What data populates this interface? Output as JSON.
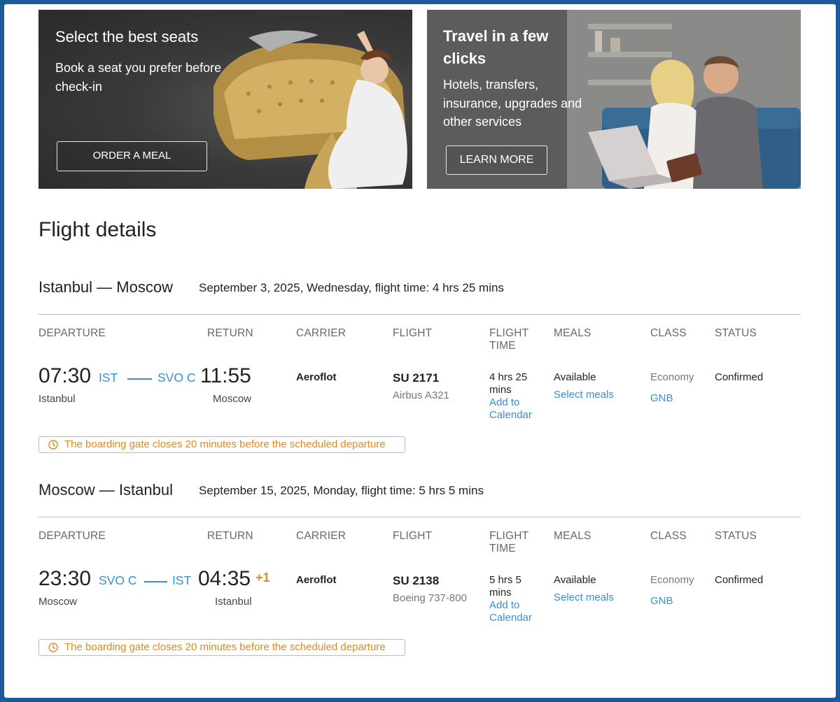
{
  "banners": [
    {
      "title": "Select the best seats",
      "text": "Book a seat you prefer before check-in",
      "button": "ORDER A MEAL"
    },
    {
      "title": "Travel in a few clicks",
      "text": "Hotels, transfers, insurance, upgrades and other services",
      "button": "LEARN MORE"
    }
  ],
  "page_title": "Flight details",
  "columns": {
    "departure": "DEPARTURE",
    "return": "RETURN",
    "carrier": "CARRIER",
    "flight": "FLIGHT",
    "flight_time": "FLIGHT TIME",
    "meals": "MEALS",
    "class": "CLASS",
    "status": "STATUS"
  },
  "segments": [
    {
      "route": "Istanbul — Moscow",
      "info": "September 3, 2025, Wednesday, flight time: 4 hrs 25 mins",
      "dep_time": "07:30",
      "dep_code": "IST",
      "dep_city": "Istanbul",
      "arr_code": "SVO C",
      "arr_time": "11:55",
      "arr_plus": "",
      "arr_city": "Moscow",
      "carrier": "Aeroflot",
      "flight_no": "SU 2171",
      "aircraft": "Airbus A321",
      "duration": "4 hrs 25 mins",
      "calendar": "Add to Calendar",
      "meals_status": "Available",
      "meals_link": "Select meals",
      "class": "Economy",
      "fare": "GNB",
      "status": "Confirmed",
      "notice": "The boarding gate closes 20 minutes before the scheduled departure"
    },
    {
      "route": "Moscow — Istanbul",
      "info": "September 15, 2025, Monday, flight time: 5 hrs 5 mins",
      "dep_time": "23:30",
      "dep_code": "SVO C",
      "dep_city": "Moscow",
      "arr_code": "IST",
      "arr_time": "04:35",
      "arr_plus": "+1",
      "arr_city": "Istanbul",
      "carrier": "Aeroflot",
      "flight_no": "SU 2138",
      "aircraft": "Boeing 737-800",
      "duration": "5 hrs 5 mins",
      "calendar": "Add to Calendar",
      "meals_status": "Available",
      "meals_link": "Select meals",
      "class": "Economy",
      "fare": "GNB",
      "status": "Confirmed",
      "notice": "The boarding gate closes 20 minutes before the scheduled departure"
    }
  ],
  "colors": {
    "link": "#3a8fd0",
    "warning": "#e08a1e",
    "frame": "#1d5a99"
  }
}
